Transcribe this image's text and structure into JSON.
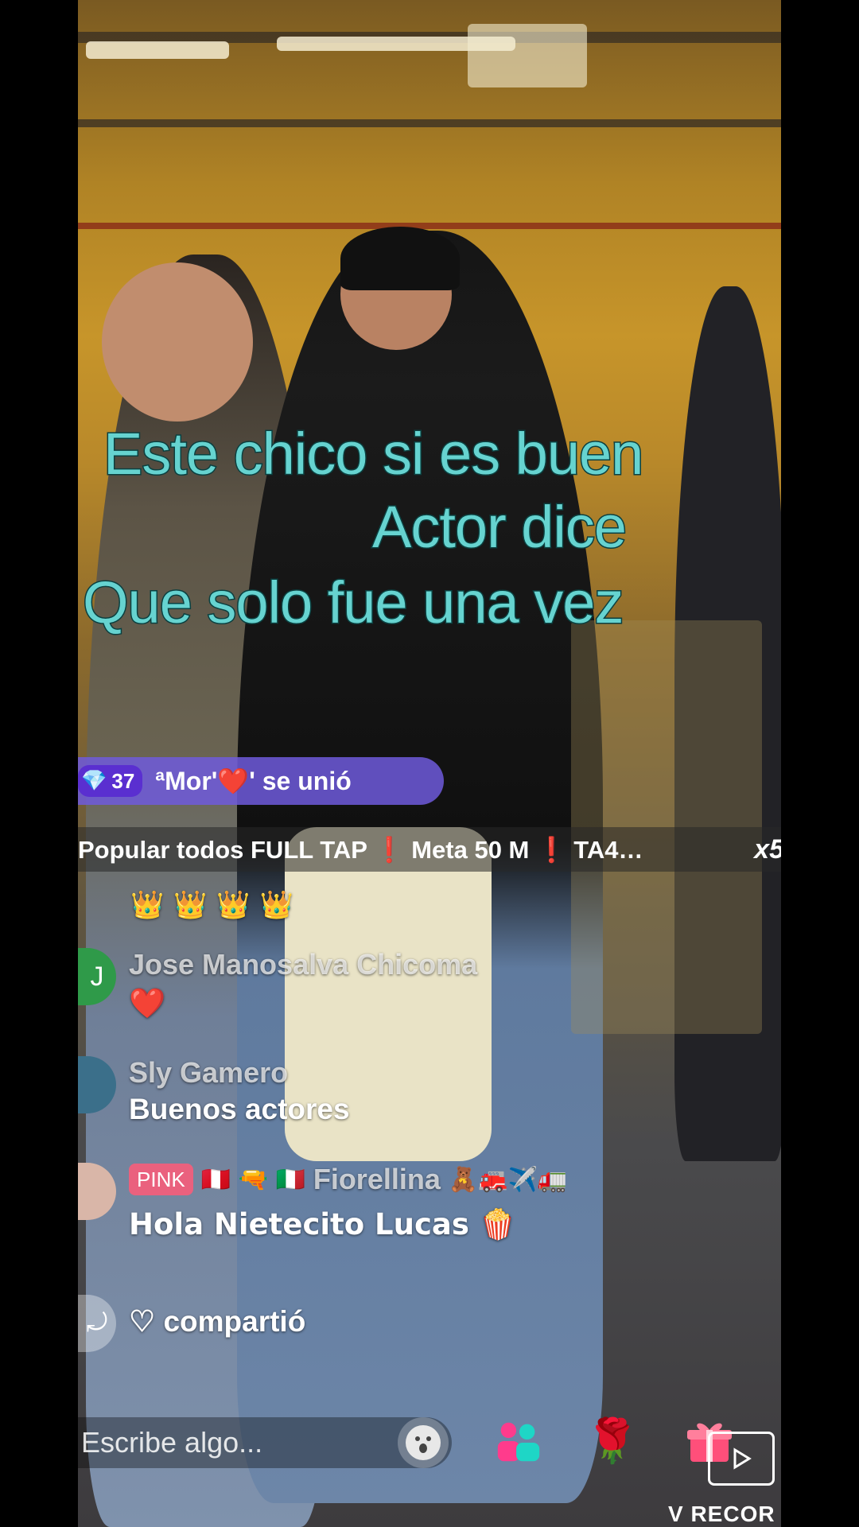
{
  "caption": {
    "line1": "Este chico si es buen",
    "line2": "Actor  dice",
    "line3": "Que solo fue una vez"
  },
  "join_banner": {
    "level": "37",
    "text": "ªMor'❤️' se unió"
  },
  "ticker": {
    "text": "Popular todos FULL TAP ❗ Meta 50 M ❗ TA4…",
    "multiplier": "x5"
  },
  "comments": [
    {
      "name": "",
      "text": "👑 👑 👑 👑",
      "avatar": ""
    },
    {
      "name": "Jose Manosalva Chicoma",
      "text": "❤️",
      "avatar": "J"
    },
    {
      "name": "Sly Gamero",
      "text": "Buenos actores",
      "avatar": ""
    },
    {
      "badge": "PINK",
      "name": "Fiorellina",
      "flags": "🇵🇪 🔫 🇮🇹",
      "emojis": "🧸🚒✈️🚛",
      "text": "Hola Nietecito Lucas 🍿",
      "avatar": ""
    },
    {
      "name": "",
      "text": "♡ compartió",
      "avatar": ""
    }
  ],
  "input": {
    "placeholder": "Escribe algo..."
  },
  "watermark": "V RECOR",
  "colors": {
    "caption": "#66d3d0",
    "caption_stroke": "#0b4040",
    "banner": "#6e5adc",
    "pink": "#ff5a78"
  }
}
